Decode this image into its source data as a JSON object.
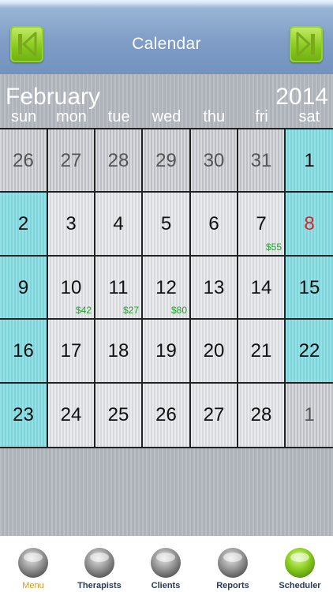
{
  "header": {
    "title": "Calendar",
    "prev_icon": "skip-back-icon",
    "next_icon": "skip-forward-icon"
  },
  "calendar": {
    "month": "February",
    "year": "2014",
    "weekdays": [
      "sun",
      "mon",
      "tue",
      "wed",
      "thu",
      "fri",
      "sat"
    ],
    "weeks": [
      [
        {
          "day": "26",
          "type": "other"
        },
        {
          "day": "27",
          "type": "other"
        },
        {
          "day": "28",
          "type": "other"
        },
        {
          "day": "29",
          "type": "other"
        },
        {
          "day": "30",
          "type": "other"
        },
        {
          "day": "31",
          "type": "other"
        },
        {
          "day": "1",
          "type": "weekend"
        }
      ],
      [
        {
          "day": "2",
          "type": "weekend"
        },
        {
          "day": "3",
          "type": "cur"
        },
        {
          "day": "4",
          "type": "cur"
        },
        {
          "day": "5",
          "type": "cur"
        },
        {
          "day": "6",
          "type": "cur"
        },
        {
          "day": "7",
          "type": "cur",
          "amount": "$55"
        },
        {
          "day": "8",
          "type": "weekend",
          "holiday": true
        }
      ],
      [
        {
          "day": "9",
          "type": "weekend"
        },
        {
          "day": "10",
          "type": "cur",
          "amount": "$42"
        },
        {
          "day": "11",
          "type": "cur",
          "amount": "$27"
        },
        {
          "day": "12",
          "type": "cur",
          "amount": "$80"
        },
        {
          "day": "13",
          "type": "cur"
        },
        {
          "day": "14",
          "type": "cur"
        },
        {
          "day": "15",
          "type": "weekend"
        }
      ],
      [
        {
          "day": "16",
          "type": "weekend"
        },
        {
          "day": "17",
          "type": "cur"
        },
        {
          "day": "18",
          "type": "cur"
        },
        {
          "day": "19",
          "type": "cur"
        },
        {
          "day": "20",
          "type": "cur"
        },
        {
          "day": "21",
          "type": "cur"
        },
        {
          "day": "22",
          "type": "weekend"
        }
      ],
      [
        {
          "day": "23",
          "type": "weekend"
        },
        {
          "day": "24",
          "type": "cur"
        },
        {
          "day": "25",
          "type": "cur"
        },
        {
          "day": "26",
          "type": "cur"
        },
        {
          "day": "27",
          "type": "cur"
        },
        {
          "day": "28",
          "type": "cur"
        },
        {
          "day": "1",
          "type": "other"
        }
      ]
    ]
  },
  "tabs": [
    {
      "label": "Menu",
      "name": "menu",
      "active": true,
      "ball": "gray"
    },
    {
      "label": "Therapists",
      "name": "therapists",
      "ball": "gray"
    },
    {
      "label": "Clients",
      "name": "clients",
      "ball": "gray"
    },
    {
      "label": "Reports",
      "name": "reports",
      "ball": "gray"
    },
    {
      "label": "Scheduler",
      "name": "scheduler",
      "ball": "green"
    }
  ],
  "colors": {
    "accent_green": "#86c71c",
    "weekend_cyan": "#7fd9e0",
    "amount_green": "#21a32b",
    "holiday_red": "#e02424",
    "header_blue": "#7f9dc6"
  }
}
